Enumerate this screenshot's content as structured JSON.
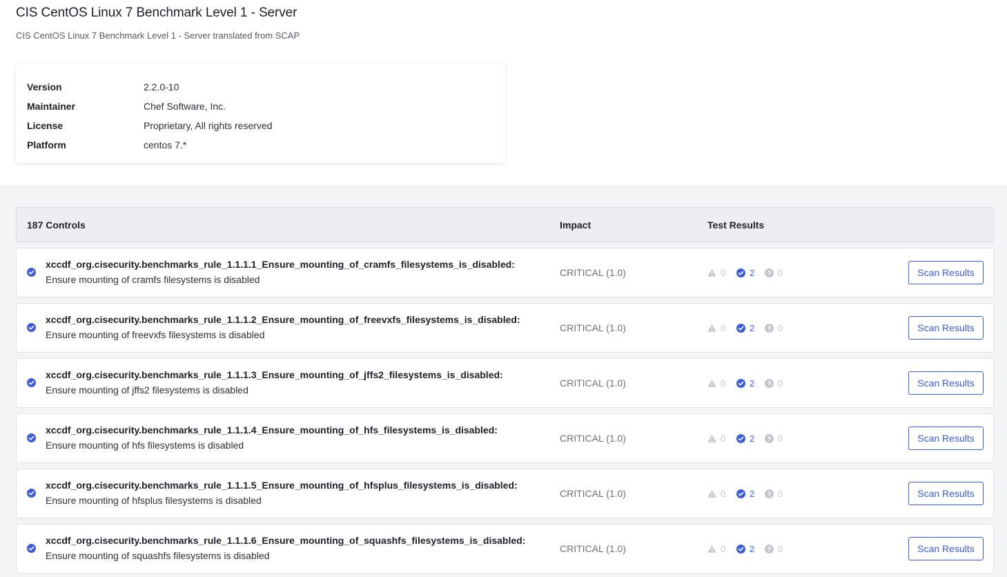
{
  "profile": {
    "title": "CIS CentOS Linux 7 Benchmark Level 1 - Server",
    "subtitle": "CIS CentOS Linux 7 Benchmark Level 1 - Server translated from SCAP"
  },
  "metadata": [
    {
      "key": "Version",
      "value": "2.2.0-10"
    },
    {
      "key": "Maintainer",
      "value": "Chef Software, Inc."
    },
    {
      "key": "License",
      "value": "Proprietary, All rights reserved"
    },
    {
      "key": "Platform",
      "value": "centos 7.*"
    }
  ],
  "controls_header": {
    "count": "187 Controls",
    "impact": "Impact",
    "results": "Test Results"
  },
  "scan_button_label": "Scan Results",
  "colors": {
    "accent": "#3b5bdb",
    "muted": "#c3c6cc"
  },
  "controls": [
    {
      "title": "xccdf_org.cisecurity.benchmarks_rule_1.1.1.1_Ensure_mounting_of_cramfs_filesystems_is_disabled:",
      "desc": "Ensure mounting of cramfs filesystems is disabled",
      "impact": "CRITICAL (1.0)",
      "failed": "0",
      "passed": "2",
      "skipped": "0"
    },
    {
      "title": "xccdf_org.cisecurity.benchmarks_rule_1.1.1.2_Ensure_mounting_of_freevxfs_filesystems_is_disabled:",
      "desc": "Ensure mounting of freevxfs filesystems is disabled",
      "impact": "CRITICAL (1.0)",
      "failed": "0",
      "passed": "2",
      "skipped": "0"
    },
    {
      "title": "xccdf_org.cisecurity.benchmarks_rule_1.1.1.3_Ensure_mounting_of_jffs2_filesystems_is_disabled:",
      "desc": "Ensure mounting of jffs2 filesystems is disabled",
      "impact": "CRITICAL (1.0)",
      "failed": "0",
      "passed": "2",
      "skipped": "0"
    },
    {
      "title": "xccdf_org.cisecurity.benchmarks_rule_1.1.1.4_Ensure_mounting_of_hfs_filesystems_is_disabled:",
      "desc": "Ensure mounting of hfs filesystems is disabled",
      "impact": "CRITICAL (1.0)",
      "failed": "0",
      "passed": "2",
      "skipped": "0"
    },
    {
      "title": "xccdf_org.cisecurity.benchmarks_rule_1.1.1.5_Ensure_mounting_of_hfsplus_filesystems_is_disabled:",
      "desc": "Ensure mounting of hfsplus filesystems is disabled",
      "impact": "CRITICAL (1.0)",
      "failed": "0",
      "passed": "2",
      "skipped": "0"
    },
    {
      "title": "xccdf_org.cisecurity.benchmarks_rule_1.1.1.6_Ensure_mounting_of_squashfs_filesystems_is_disabled:",
      "desc": "Ensure mounting of squashfs filesystems is disabled",
      "impact": "CRITICAL (1.0)",
      "failed": "0",
      "passed": "2",
      "skipped": "0"
    }
  ]
}
